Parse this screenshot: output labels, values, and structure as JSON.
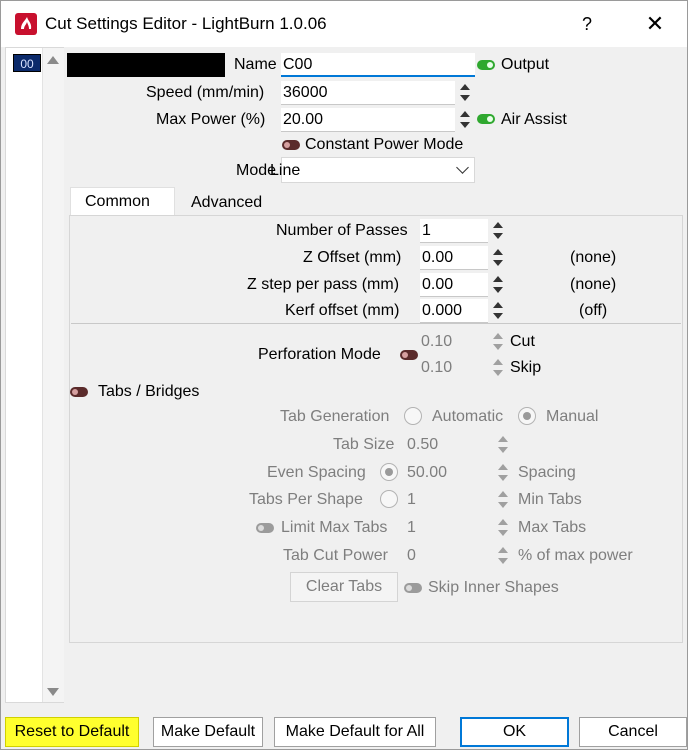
{
  "window": {
    "title": "Cut Settings Editor - LightBurn 1.0.06",
    "help_label": "?",
    "close_label": "✕"
  },
  "layer_list": {
    "selected_layer": "00"
  },
  "top": {
    "name_label": "Name",
    "name_value": "C00",
    "output_label": "Output",
    "speed_label": "Speed (mm/min)",
    "speed_value": "36000",
    "max_power_label": "Max Power (%)",
    "max_power_value": "20.00",
    "air_assist_label": "Air Assist",
    "constant_power_label": "Constant Power Mode",
    "mode_label": "Mode",
    "mode_value": "Line"
  },
  "tabs": [
    {
      "label": "Common",
      "active": true
    },
    {
      "label": "Advanced",
      "active": false
    }
  ],
  "common": {
    "passes_label": "Number of Passes",
    "passes_value": "1",
    "z_offset_label": "Z Offset (mm)",
    "z_offset_value": "0.00",
    "z_offset_note": "(none)",
    "z_step_label": "Z step per pass (mm)",
    "z_step_value": "0.00",
    "z_step_note": "(none)",
    "kerf_label": "Kerf offset (mm)",
    "kerf_value": "0.000",
    "kerf_note": "(off)",
    "perforation_label": "Perforation Mode",
    "cut_value": "0.10",
    "cut_label": "Cut",
    "skip_value": "0.10",
    "skip_label": "Skip"
  },
  "tabs_bridges": {
    "section_label": "Tabs / Bridges",
    "tab_generation_label": "Tab Generation",
    "automatic_label": "Automatic",
    "manual_label": "Manual",
    "tab_size_label": "Tab Size",
    "tab_size_value": "0.50",
    "even_spacing_label": "Even Spacing",
    "even_spacing_value": "50.00",
    "spacing_label": "Spacing",
    "tabs_per_shape_label": "Tabs Per Shape",
    "tabs_per_shape_value": "1",
    "min_tabs_label": "Min Tabs",
    "limit_max_tabs_label": "Limit Max Tabs",
    "limit_max_tabs_value": "1",
    "max_tabs_label": "Max Tabs",
    "tab_cut_power_label": "Tab Cut Power",
    "tab_cut_power_value": "0",
    "pct_max_power_label": "% of max power",
    "clear_tabs_label": "Clear Tabs",
    "skip_inner_label": "Skip Inner Shapes"
  },
  "footer": {
    "reset_label": "Reset to Default",
    "make_default_label": "Make Default",
    "make_default_all_label": "Make Default for All",
    "ok_label": "OK",
    "cancel_label": "Cancel"
  },
  "colors": {
    "accent": "#0078d7",
    "toggle_on": "#2fa82f",
    "layer_chip": "#0b2a6b",
    "highlight": "#ffff2e"
  }
}
